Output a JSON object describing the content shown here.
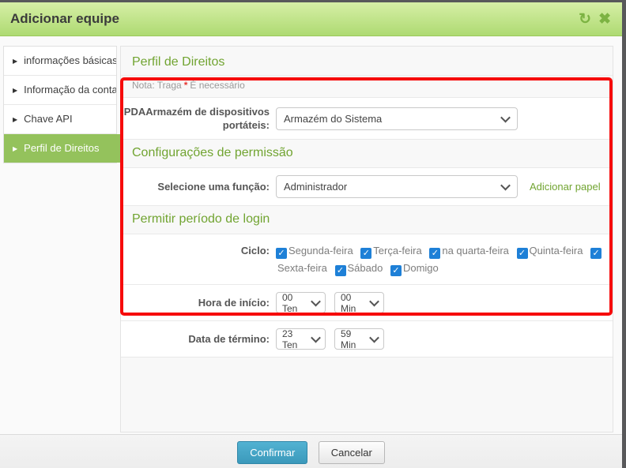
{
  "window": {
    "title": "Adicionar equipe",
    "refresh_icon": "↻",
    "close_icon": "✖"
  },
  "sidebar": {
    "items": [
      {
        "id": "informacoes-basicas",
        "label": "informações básicas",
        "active": false
      },
      {
        "id": "informacao-da-conta",
        "label": "Informação da conta",
        "active": false
      },
      {
        "id": "chave-api",
        "label": "Chave API",
        "active": false
      },
      {
        "id": "perfil-de-direitos",
        "label": "Perfil de Direitos",
        "active": true
      }
    ]
  },
  "panel": {
    "title": "Perfil de Direitos",
    "note": {
      "prefix": "Nota: Traga",
      "star": "*",
      "suffix": "É necessário"
    },
    "pda_row": {
      "label_line1": "PDAArmazém de dispositivos",
      "label_line2": "portáteis:",
      "select_value": "Armazém do Sistema"
    },
    "permission_section": {
      "heading": "Configurações de permissão",
      "role_label": "Selecione uma função:",
      "role_value": "Administrador",
      "add_role_link": "Adicionar papel"
    },
    "login_section": {
      "heading": "Permitir período de login",
      "cycle_label": "Ciclo:",
      "days": [
        {
          "label": "Segunda-feira",
          "checked": true
        },
        {
          "label": "Terça-feira",
          "checked": true
        },
        {
          "label": "na quarta-feira",
          "checked": true
        },
        {
          "label": "Quinta-feira",
          "checked": true
        },
        {
          "label": "Sexta-feira",
          "checked": true
        },
        {
          "label": "Sábado",
          "checked": true
        },
        {
          "label": "Domigo",
          "checked": true
        }
      ],
      "line_break_after_checkbox_index": 4,
      "start_label": "Hora de início:",
      "start_hour": "00 Ten",
      "start_min": "00 Min",
      "end_label": "Data de término:",
      "end_hour": "23 Ten",
      "end_min": "59 Min"
    }
  },
  "footer": {
    "confirm_label": "Confirmar",
    "cancel_label": "Cancelar"
  },
  "colors": {
    "header_green_top": "#d6efa6",
    "header_green_bottom": "#aeda72",
    "accent_green": "#71a431",
    "active_item_green": "#94c25c",
    "checkbox_blue": "#1e80d7",
    "annotation_red": "#f60b0b",
    "confirm_teal": "#3b99bb",
    "required_red": "#e53935"
  }
}
